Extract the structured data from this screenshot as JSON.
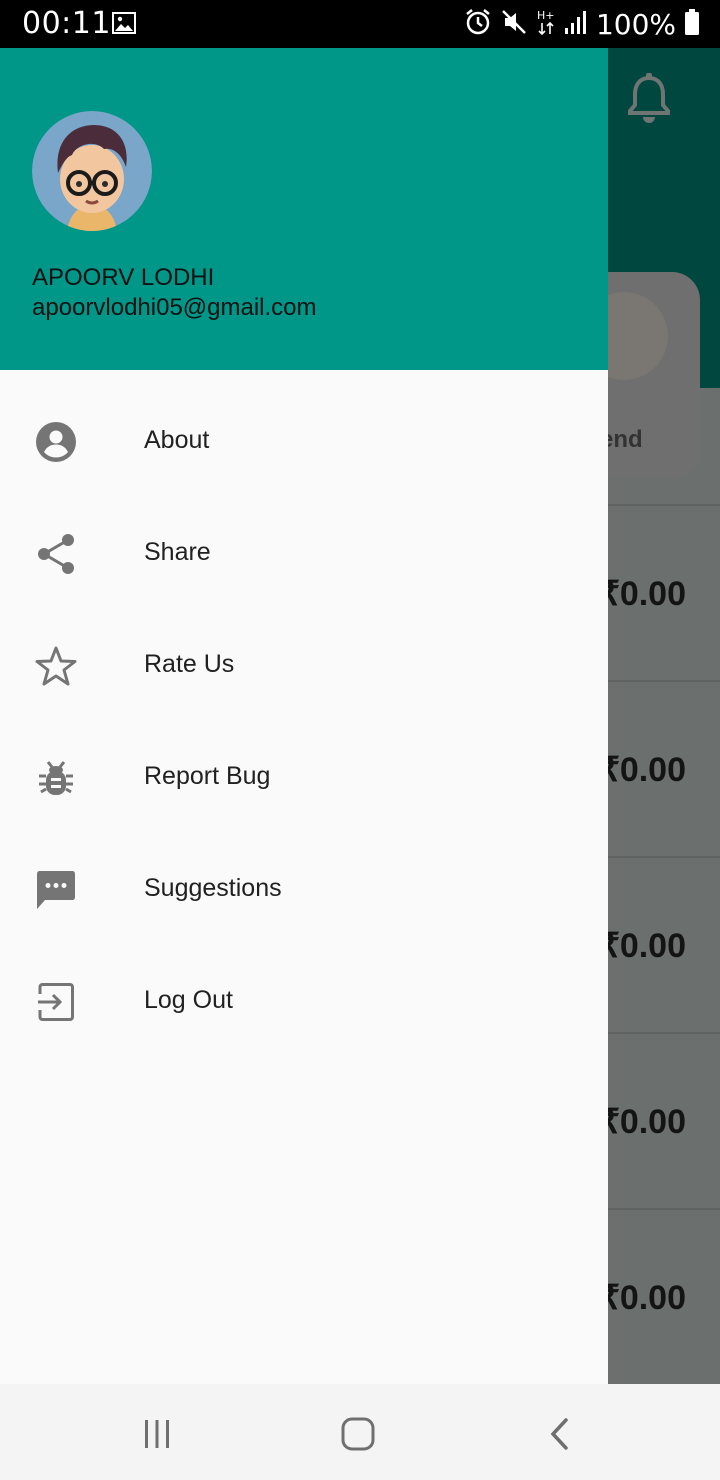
{
  "status_bar": {
    "time": "00:11",
    "battery": "100%",
    "icons": [
      "image-icon",
      "alarm-icon",
      "mute-icon",
      "h-plus-icon",
      "signal-icon",
      "battery-icon"
    ]
  },
  "background": {
    "card_label": "end",
    "amounts": [
      "₹0.00",
      "₹0.00",
      "₹0.00",
      "₹0.00",
      "₹0.00"
    ]
  },
  "drawer": {
    "header": {
      "name": "APOORV LODHI",
      "email": "apoorvlodhi05@gmail.com"
    },
    "menu": [
      {
        "label": "About",
        "icon": "account-circle-icon"
      },
      {
        "label": "Share",
        "icon": "share-icon"
      },
      {
        "label": "Rate Us",
        "icon": "star-outline-icon"
      },
      {
        "label": "Report Bug",
        "icon": "bug-icon"
      },
      {
        "label": "Suggestions",
        "icon": "chat-bubble-icon"
      },
      {
        "label": "Log Out",
        "icon": "exit-icon"
      }
    ]
  },
  "colors": {
    "accent": "#009688",
    "drawer_bg": "#fafafa",
    "icon_gray": "#757575",
    "text": "#212121"
  },
  "nav_bar": {
    "buttons": [
      "recents-button",
      "home-button",
      "back-button"
    ]
  }
}
